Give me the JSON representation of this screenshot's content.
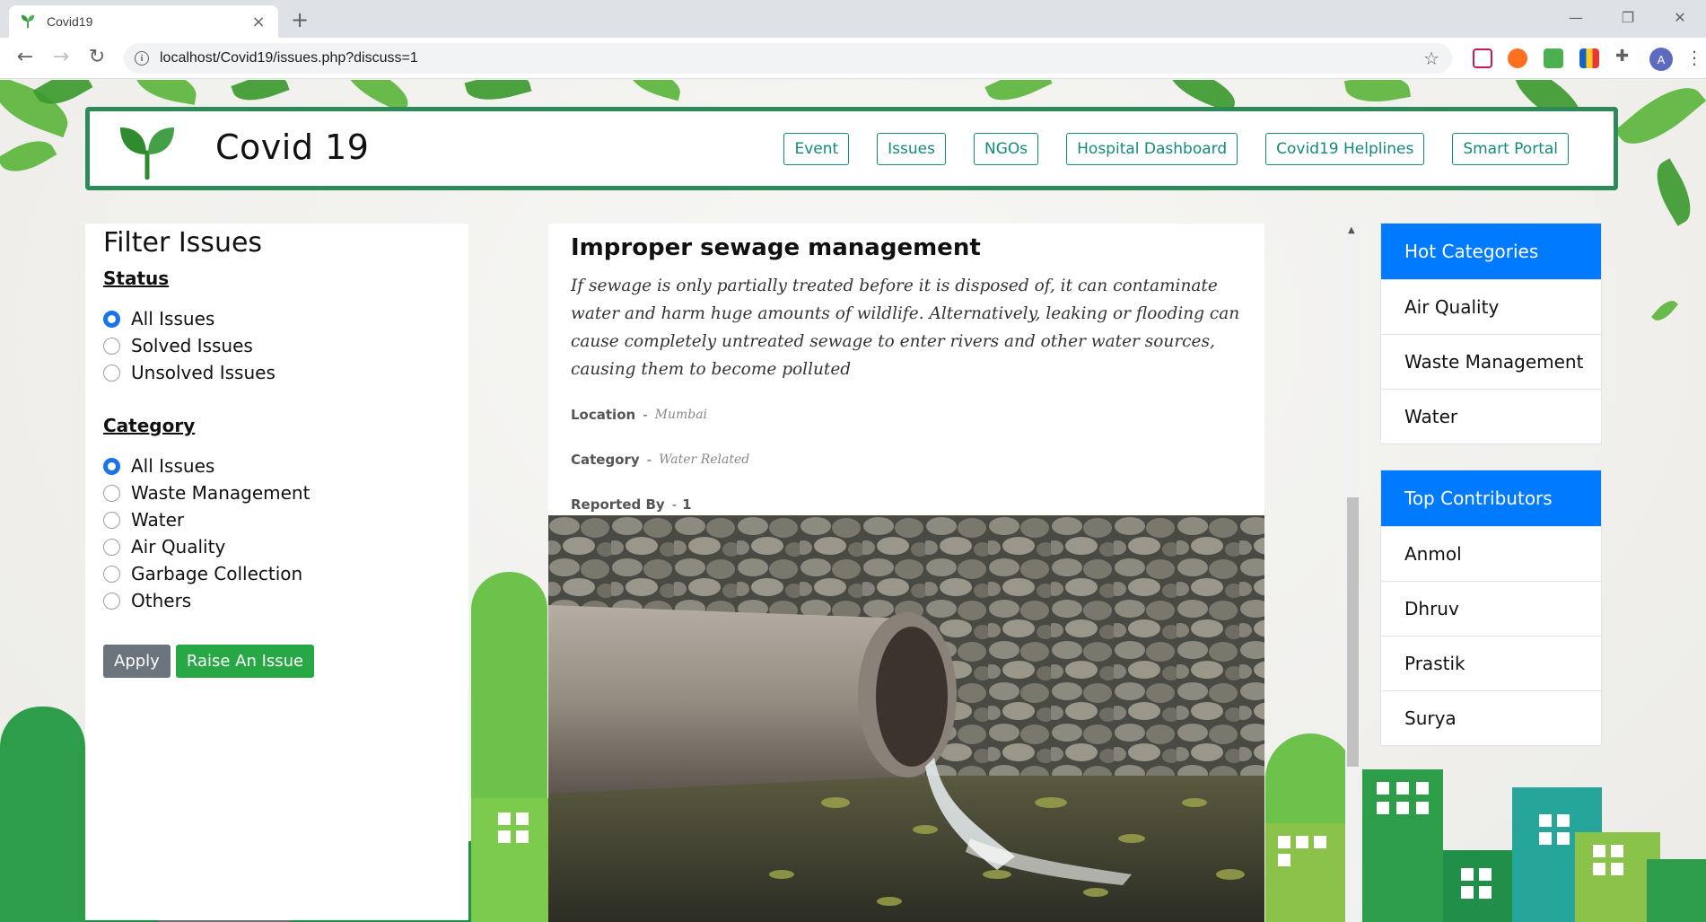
{
  "browser": {
    "tab_title": "Covid19",
    "tab_close": "×",
    "new_tab": "+",
    "url": "localhost/Covid19/issues.php?discuss=1",
    "profile_initial": "A",
    "window_controls": [
      "—",
      "❐",
      "✕"
    ]
  },
  "header": {
    "brand_title": "Covid 19",
    "nav": [
      "Event",
      "Issues",
      "NGOs",
      "Hospital Dashboard",
      "Covid19 Helplines",
      "Smart Portal"
    ]
  },
  "filter": {
    "title": "Filter Issues",
    "status_title": "Status",
    "status_options": [
      "All Issues",
      "Solved Issues",
      "Unsolved Issues"
    ],
    "status_selected": "All Issues",
    "category_title": "Category",
    "category_options": [
      "All Issues",
      "Waste Management",
      "Water",
      "Air Quality",
      "Garbage Collection",
      "Others"
    ],
    "category_selected": "All Issues",
    "apply_label": "Apply",
    "raise_label": "Raise An Issue"
  },
  "issue": {
    "title": "Improper sewage management",
    "description": "If sewage is only partially treated before it is disposed of, it can contaminate water and harm huge amounts of wildlife. Alternatively, leaking or flooding can cause completely untreated sewage to enter rivers and other water sources, causing them to become polluted",
    "location_label": "Location",
    "location_value": "Mumbai",
    "category_label": "Category",
    "category_value": "Water Related",
    "reported_label": "Reported By",
    "reported_value": "1",
    "separator": "-"
  },
  "hot_categories": {
    "title": "Hot Categories",
    "items": [
      "Air Quality",
      "Waste Management",
      "Water"
    ]
  },
  "top_contributors": {
    "title": "Top Contributors",
    "items": [
      "Anmol",
      "Dhruv",
      "Prastik",
      "Surya"
    ]
  },
  "colors": {
    "brand_green": "#2f8a5a",
    "nav_teal": "#138a7a",
    "primary_blue": "#007bff",
    "apply_gray": "#6c757d",
    "raise_green": "#28a745"
  }
}
